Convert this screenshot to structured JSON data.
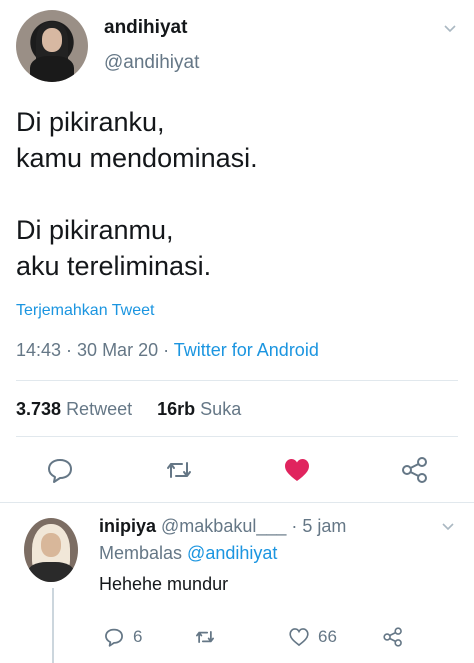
{
  "tweet": {
    "display_name": "andihiyat",
    "handle": "@andihiyat",
    "text": "Di pikiranku,\nkamu mendominasi.\n\nDi pikiranmu,\naku tereliminasi.",
    "translate_label": "Terjemahkan Tweet",
    "timestamp": "14:43 · 30 Mar 20 · ",
    "source": "Twitter for Android",
    "retweet_count": "3.738",
    "retweet_label": "Retweet",
    "like_count": "16rb",
    "like_label": "Suka",
    "liked": true
  },
  "reply": {
    "display_name": "inipiya",
    "handle": "@makbakul___",
    "time": "· 5 jam",
    "replying_prefix": "Membalas",
    "replying_to": "@andihiyat",
    "text": "Hehehe mundur",
    "reply_count": "6",
    "like_count": "66"
  },
  "icons": [
    "chevron-down-icon",
    "reply-icon",
    "retweet-icon",
    "heart-icon",
    "share-icon"
  ],
  "colors": {
    "accent_blue": "#1b95e0",
    "like_red": "#e0245e",
    "muted_gray": "#657786",
    "divider": "#e1e8ed"
  }
}
